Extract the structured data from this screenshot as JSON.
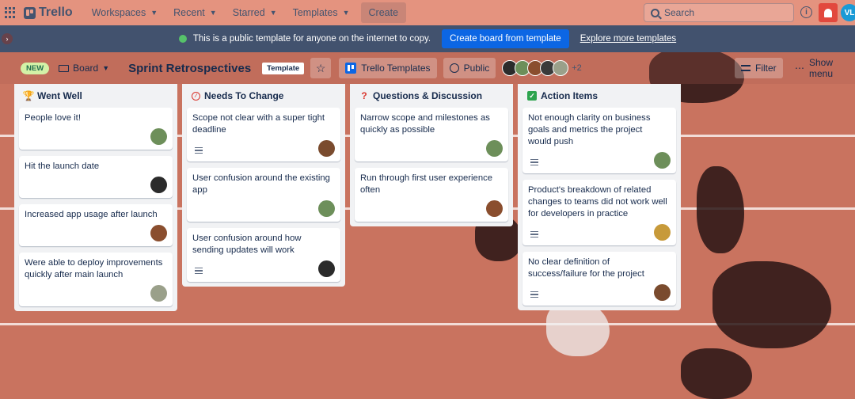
{
  "nav": {
    "logo_text": "Trello",
    "items": [
      "Workspaces",
      "Recent",
      "Starred",
      "Templates"
    ],
    "create_label": "Create",
    "search_placeholder": "Search",
    "info_glyph": "i",
    "user_initials": "VL"
  },
  "banner": {
    "message": "This is a public template for anyone on the internet to copy.",
    "cta_label": "Create board from template",
    "link_label": "Explore more templates"
  },
  "board": {
    "new_badge": "NEW",
    "view_label": "Board",
    "title": "Sprint Retrospectives",
    "template_badge": "Template",
    "workspace_label": "Trello Templates",
    "visibility_label": "Public",
    "members_more": "+2",
    "filter_label": "Filter",
    "show_menu_label": "Show menu"
  },
  "lists": [
    {
      "title": "Went Well",
      "emoji": "trophy-icon",
      "cards": [
        {
          "text": "People love it!",
          "has_description": false,
          "avatar_color": "#6d8f5a"
        },
        {
          "text": "Hit the launch date",
          "has_description": false,
          "avatar_color": "#2b2b2b"
        },
        {
          "text": "Increased app usage after launch",
          "has_description": false,
          "avatar_color": "#8a4e2e"
        },
        {
          "text": "Were able to deploy improvements quickly after main launch",
          "has_description": false,
          "avatar_color": "#9aa08a"
        }
      ]
    },
    {
      "title": "Needs To Change",
      "emoji": "no-entry-icon",
      "cards": [
        {
          "text": "Scope not clear with a super tight deadline",
          "has_description": true,
          "avatar_color": "#7a4b2e"
        },
        {
          "text": "User confusion around the existing app",
          "has_description": false,
          "avatar_color": "#6d8f5a"
        },
        {
          "text": "User confusion around how sending updates will work",
          "has_description": true,
          "avatar_color": "#2b2b2b"
        }
      ]
    },
    {
      "title": "Questions & Discussion",
      "emoji": "question-icon",
      "cards": [
        {
          "text": "Narrow scope and milestones as quickly as possible",
          "has_description": false,
          "avatar_color": "#6d8f5a"
        },
        {
          "text": "Run through first user experience often",
          "has_description": false,
          "avatar_color": "#8a4e2e"
        }
      ]
    },
    {
      "title": "Action Items",
      "emoji": "check-icon",
      "cards": [
        {
          "text": "Not enough clarity on business goals and metrics the project would push",
          "has_description": true,
          "avatar_color": "#6d8f5a"
        },
        {
          "text": "Product's breakdown of related changes to teams did not work well for developers in practice",
          "has_description": true,
          "avatar_color": "#c79a3a"
        },
        {
          "text": "No clear definition of success/failure for the project",
          "has_description": true,
          "avatar_color": "#7a4b2e"
        }
      ]
    }
  ],
  "member_avatar_colors": [
    "#2b2b2b",
    "#6d8f5a",
    "#8a4e2e",
    "#3a3a3a",
    "#9aa08a"
  ]
}
